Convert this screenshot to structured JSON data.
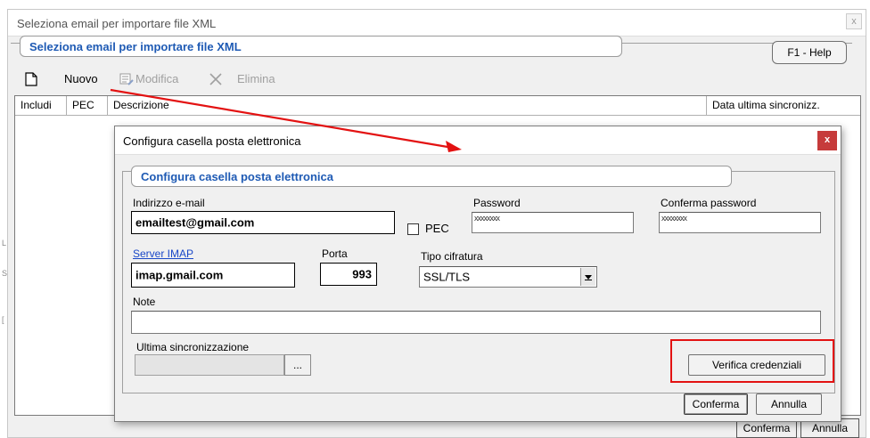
{
  "background_window": {
    "title": "Seleziona email per importare file XML",
    "close_glyph": "x",
    "group_title": "Seleziona email per importare file XML",
    "help_label": "F1 - Help",
    "toolbar": {
      "new_label": "Nuovo",
      "edit_label": "Modifica",
      "delete_label": "Elimina",
      "new_icon": "new-document-icon",
      "edit_icon": "edit-list-icon",
      "delete_icon": "delete-x-icon"
    },
    "table": {
      "columns": [
        "Includi",
        "PEC",
        "Descrizione",
        "Data ultima sincronizz."
      ]
    },
    "bottom_buttons": {
      "confirm_label": "Conferma",
      "cancel_label": "Annulla"
    }
  },
  "dialog": {
    "title": "Configura casella posta elettronica",
    "close_glyph": "x",
    "group_title": "Configura casella posta elettronica",
    "email": {
      "label": "Indirizzo e-mail",
      "value": "emailtest@gmail.com"
    },
    "pec": {
      "label": "PEC",
      "checked": false
    },
    "password": {
      "label": "Password",
      "value": "xxxxxxxx"
    },
    "confirm_password": {
      "label": "Conferma password",
      "value": "xxxxxxxx"
    },
    "server": {
      "label": "Server IMAP",
      "value": "imap.gmail.com"
    },
    "port": {
      "label": "Porta",
      "value": "993"
    },
    "encryption": {
      "label": "Tipo cifratura",
      "value": "SSL/TLS"
    },
    "note": {
      "label": "Note",
      "value": ""
    },
    "last_sync": {
      "label": "Ultima sincronizzazione",
      "value": "",
      "browse_label": "..."
    },
    "verify_label": "Verifica credenziali",
    "confirm_label": "Conferma",
    "cancel_label": "Annulla"
  },
  "colors": {
    "accent_blue": "#1e5ab4",
    "link_blue": "#1a48c8",
    "annotation_red": "#e31212",
    "close_red": "#c63b3b"
  }
}
